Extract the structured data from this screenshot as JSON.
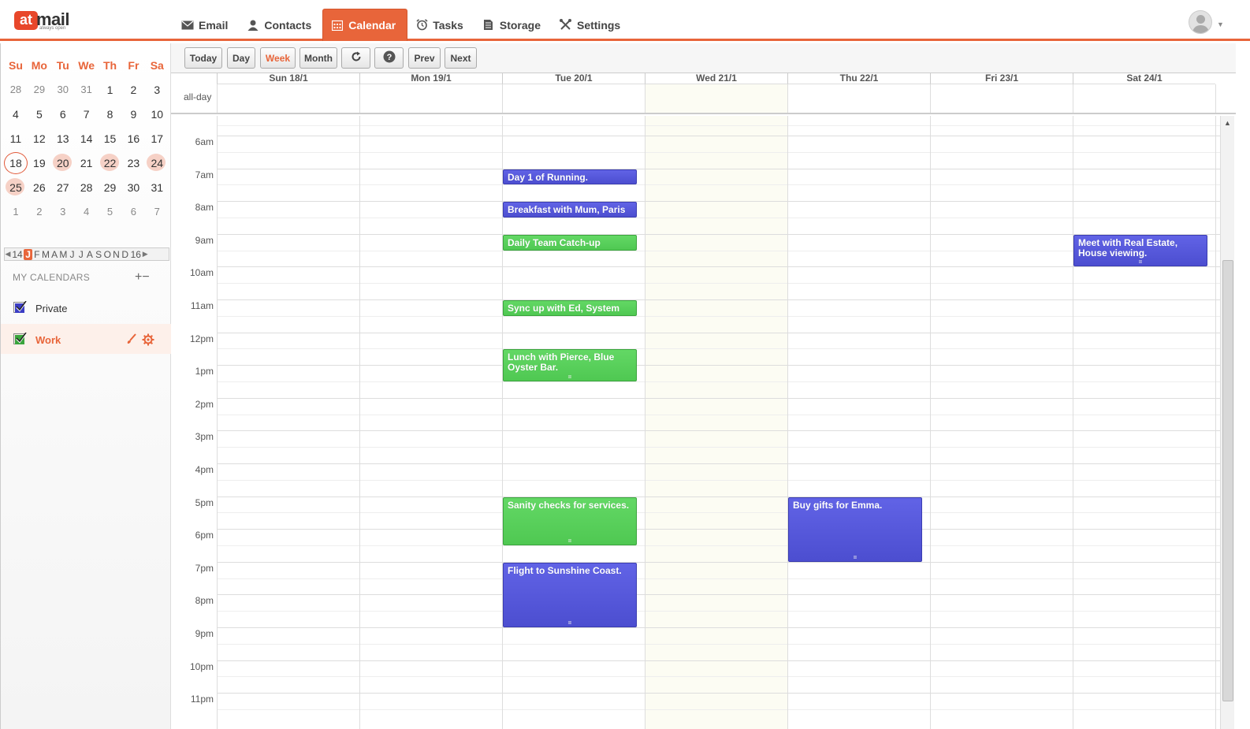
{
  "header": {
    "logo_brand": "mail",
    "logo_prefix": "at",
    "logo_tagline": "always open",
    "nav": [
      {
        "label": "Email",
        "icon": "envelope-icon"
      },
      {
        "label": "Contacts",
        "icon": "person-icon"
      },
      {
        "label": "Calendar",
        "icon": "calendar-icon",
        "active": true
      },
      {
        "label": "Tasks",
        "icon": "alarm-clock-icon"
      },
      {
        "label": "Storage",
        "icon": "document-icon"
      },
      {
        "label": "Settings",
        "icon": "tools-icon"
      }
    ]
  },
  "mini_calendar": {
    "weekdays": [
      "Su",
      "Mo",
      "Tu",
      "We",
      "Th",
      "Fr",
      "Sa"
    ],
    "weeks": [
      [
        "28",
        "29",
        "30",
        "31",
        "1",
        "2",
        "3"
      ],
      [
        "4",
        "5",
        "6",
        "7",
        "8",
        "9",
        "10"
      ],
      [
        "11",
        "12",
        "13",
        "14",
        "15",
        "16",
        "17"
      ],
      [
        "18",
        "19",
        "20",
        "21",
        "22",
        "23",
        "24"
      ],
      [
        "25",
        "26",
        "27",
        "28",
        "29",
        "30",
        "31"
      ],
      [
        "1",
        "2",
        "3",
        "4",
        "5",
        "6",
        "7"
      ]
    ],
    "today": "18",
    "busy_days": [
      "20",
      "22",
      "24",
      "25"
    ]
  },
  "month_strip": {
    "prev_year": "14",
    "months": [
      "J",
      "F",
      "M",
      "A",
      "M",
      "J",
      "J",
      "A",
      "S",
      "O",
      "N",
      "D"
    ],
    "active_index": 0,
    "next_year": "16"
  },
  "my_calendars": {
    "heading": "MY CALENDARS",
    "add_remove": "+−",
    "items": [
      {
        "label": "Private",
        "color": "#3b3dc4"
      },
      {
        "label": "Work",
        "color": "#3aa43d"
      }
    ]
  },
  "toolbar": {
    "today": "Today",
    "day": "Day",
    "week": "Week",
    "month": "Month",
    "prev": "Prev",
    "next": "Next"
  },
  "week": {
    "allday_label": "all-day",
    "days": [
      "Sun 18/1",
      "Mon 19/1",
      "Tue 20/1",
      "Wed 21/1",
      "Thu 22/1",
      "Fri 23/1",
      "Sat 24/1"
    ],
    "hours": [
      "6am",
      "7am",
      "8am",
      "9am",
      "10am",
      "11am",
      "12pm",
      "1pm",
      "2pm",
      "3pm",
      "4pm",
      "5pm",
      "6pm",
      "7pm",
      "8pm",
      "9pm",
      "10pm",
      "11pm"
    ]
  },
  "events": [
    {
      "title": "Day 1 of Running.",
      "day": "Tue 20/1",
      "start": "7:00",
      "end": "7:30",
      "calendar": "Private"
    },
    {
      "title": "Breakfast with Mum, Paris",
      "day": "Tue 20/1",
      "start": "8:00",
      "end": "8:30",
      "calendar": "Private"
    },
    {
      "title": "Daily Team Catch-up",
      "day": "Tue 20/1",
      "start": "9:00",
      "end": "9:30",
      "calendar": "Work"
    },
    {
      "title": "Sync up with Ed, System",
      "day": "Tue 20/1",
      "start": "11:00",
      "end": "11:30",
      "calendar": "Work"
    },
    {
      "title": "Lunch with Pierce, Blue Oyster Bar.",
      "day": "Tue 20/1",
      "start": "12:30",
      "end": "13:30",
      "calendar": "Work"
    },
    {
      "title": "Sanity checks for services.",
      "day": "Tue 20/1",
      "start": "17:00",
      "end": "18:30",
      "calendar": "Work"
    },
    {
      "title": "Flight to Sunshine Coast.",
      "day": "Tue 20/1",
      "start": "19:00",
      "end": "21:00",
      "calendar": "Private"
    },
    {
      "title": "Buy gifts for Emma.",
      "day": "Thu 22/1",
      "start": "17:00",
      "end": "19:00",
      "calendar": "Private"
    },
    {
      "title": "Meet with Real Estate, House viewing.",
      "day": "Sat 24/1",
      "start": "9:00",
      "end": "10:00",
      "calendar": "Private"
    }
  ]
}
